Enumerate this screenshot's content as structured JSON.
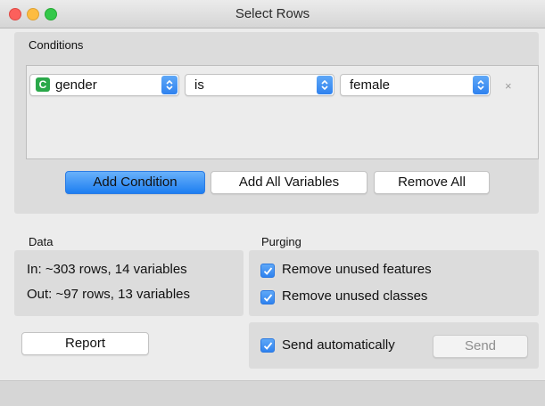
{
  "window": {
    "title": "Select Rows"
  },
  "conditions": {
    "label": "Conditions",
    "rows": [
      {
        "variable": "gender",
        "variable_icon": "C",
        "operator": "is",
        "value": "female",
        "remove": "×"
      }
    ],
    "buttons": {
      "add_condition": "Add Condition",
      "add_all_variables": "Add All Variables",
      "remove_all": "Remove All"
    }
  },
  "data": {
    "label": "Data",
    "in_text": "In: ~303 rows, 14 variables",
    "out_text": "Out: ~97 rows, 13 variables"
  },
  "purging": {
    "label": "Purging",
    "remove_unused_features": {
      "label": "Remove unused features",
      "checked": true
    },
    "remove_unused_classes": {
      "label": "Remove unused classes",
      "checked": true
    }
  },
  "bottom": {
    "report_label": "Report",
    "send_automatically": {
      "label": "Send automatically",
      "checked": true
    },
    "send_label": "Send"
  },
  "colors": {
    "accent": "#2f82ef",
    "category_badge": "#2aa84a"
  },
  "icons": [
    "close-traffic-light",
    "minimize-traffic-light",
    "maximize-traffic-light",
    "updown-arrows-icon",
    "checkmark-icon",
    "categorical-variable-icon"
  ]
}
